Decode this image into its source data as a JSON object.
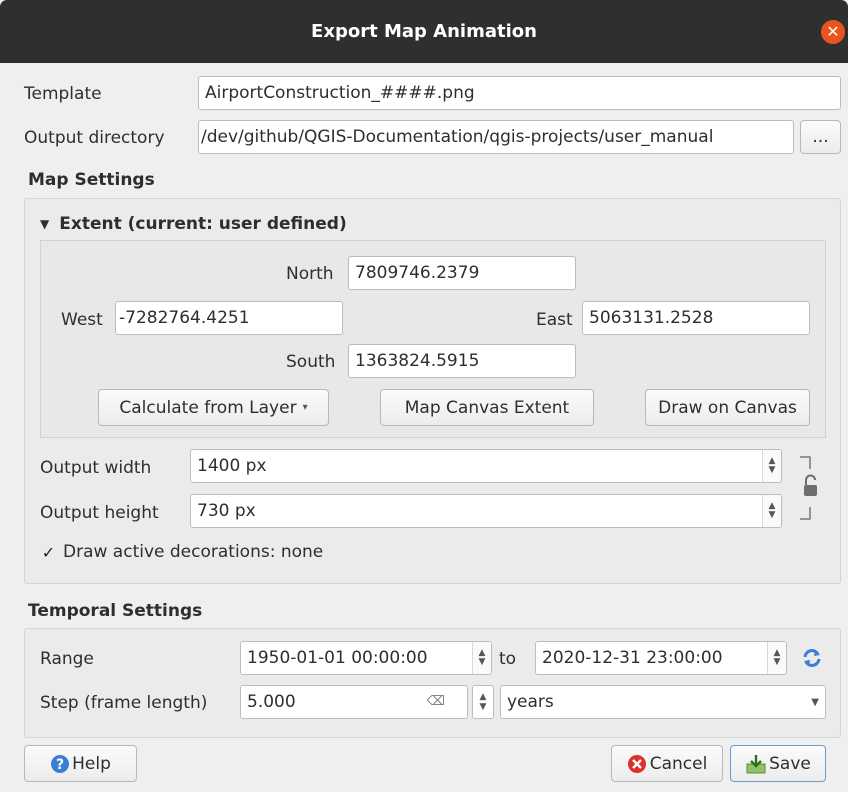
{
  "window": {
    "title": "Export Map Animation"
  },
  "template": {
    "label": "Template",
    "value": "AirportConstruction_####.png"
  },
  "output_directory": {
    "label": "Output directory",
    "value": "/dev/github/QGIS-Documentation/qgis-projects/user_manual",
    "browse_label": "..."
  },
  "map_settings": {
    "title": "Map Settings",
    "extent": {
      "title": "Extent (current: user defined)",
      "north_label": "North",
      "north_value": "7809746.2379",
      "west_label": "West",
      "west_value": "-7282764.4251",
      "east_label": "East",
      "east_value": "5063131.2528",
      "south_label": "South",
      "south_value": "1363824.5915",
      "calc_layer_label": "Calculate from Layer",
      "map_canvas_label": "Map Canvas Extent",
      "draw_canvas_label": "Draw on Canvas"
    },
    "output_width_label": "Output width",
    "output_width_value": "1400 px",
    "output_height_label": "Output height",
    "output_height_value": "730 px",
    "decorations_label": "Draw active decorations: none",
    "decorations_checked": true
  },
  "temporal_settings": {
    "title": "Temporal Settings",
    "range_label": "Range",
    "range_start": "1950-01-01 00:00:00",
    "to_label": "to",
    "range_end": "2020-12-31 23:00:00",
    "step_label": "Step (frame length)",
    "step_value": "5.000",
    "step_unit": "years"
  },
  "buttons": {
    "help": "Help",
    "cancel": "Cancel",
    "save": "Save"
  },
  "colors": {
    "titlebar": "#2f2f2f",
    "close": "#e95420",
    "help_icon": "#3b7fd4",
    "cancel_icon": "#d9322b"
  }
}
